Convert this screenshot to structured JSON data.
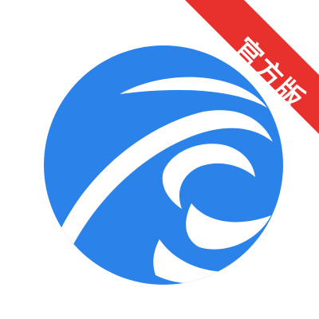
{
  "icon": {
    "name": "app-logo",
    "badge_text": "官方版",
    "colors": {
      "brand_blue": "#2b83ea",
      "badge_red": "#e8312d",
      "background": "#ffffff"
    }
  }
}
